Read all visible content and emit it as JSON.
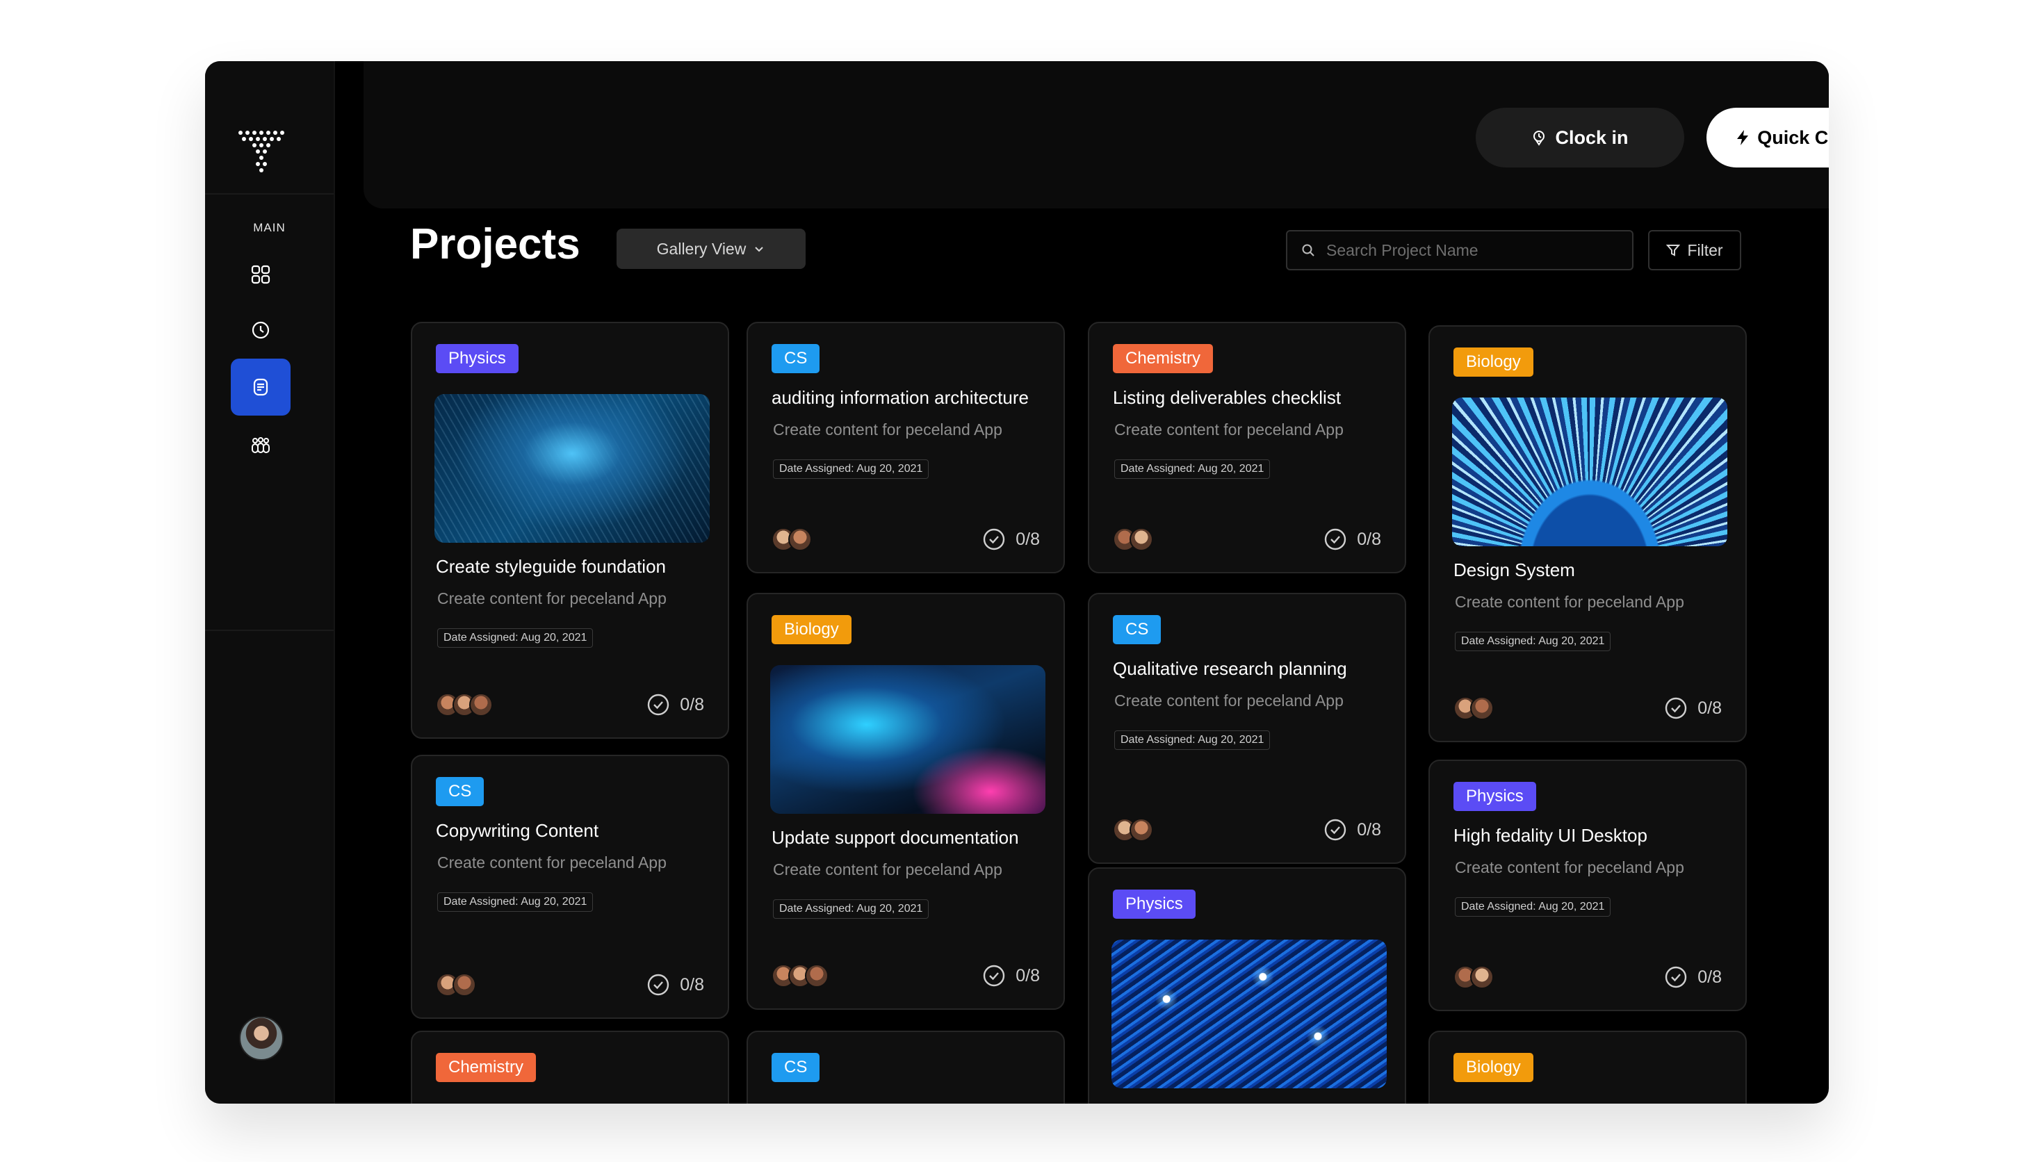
{
  "sidebar": {
    "section_label": "MAIN",
    "items": [
      {
        "icon": "grid-icon"
      },
      {
        "icon": "clock-icon"
      },
      {
        "icon": "projects-icon",
        "active": true
      },
      {
        "icon": "team-icon"
      }
    ]
  },
  "topbar": {
    "clock_in_label": "Clock in",
    "quick_clock_in_label": "Quick Clock in"
  },
  "header": {
    "title": "Projects",
    "view_selected": "Gallery View",
    "search_placeholder": "Search Project Name",
    "filter_label": "Filter"
  },
  "tag_colors": {
    "Physics": "#5b4cf5",
    "CS": "#1e9bf0",
    "Chemistry": "#f0673a",
    "Biology": "#f29b0c"
  },
  "cards": [
    {
      "tag": "Physics",
      "image": "dna",
      "title": "Create styleguide foundation",
      "subtitle": "Create content for peceland App",
      "date": "Date Assigned: Aug 20, 2021",
      "progress": "0/8",
      "avatars": 3
    },
    {
      "tag": "CS",
      "title": "Copywriting Content",
      "subtitle": "Create content for peceland App",
      "date": "Date Assigned: Aug 20, 2021",
      "progress": "0/8",
      "avatars": 2
    },
    {
      "tag": "Chemistry"
    },
    {
      "tag": "CS",
      "title": "auditing information architecture",
      "subtitle": "Create content for peceland App",
      "date": "Date Assigned: Aug 20, 2021",
      "progress": "0/8",
      "avatars": 2
    },
    {
      "tag": "Biology",
      "image": "waves",
      "title": "Update support documentation",
      "subtitle": "Create content for peceland App",
      "date": "Date Assigned: Aug 20, 2021",
      "progress": "0/8",
      "avatars": 3
    },
    {
      "tag": "CS"
    },
    {
      "tag": "Chemistry",
      "title": "Listing deliverables checklist",
      "subtitle": "Create content for peceland App",
      "date": "Date Assigned: Aug 20, 2021",
      "progress": "0/8",
      "avatars": 2
    },
    {
      "tag": "CS",
      "title": "Qualitative research planning",
      "subtitle": "Create content for peceland App",
      "date": "Date Assigned: Aug 20, 2021",
      "progress": "0/8",
      "avatars": 2
    },
    {
      "tag": "Physics",
      "image": "circuit"
    },
    {
      "tag": "Biology",
      "image": "burst",
      "title": "Design System",
      "subtitle": "Create content for peceland App",
      "date": "Date Assigned: Aug 20, 2021",
      "progress": "0/8",
      "avatars": 2
    },
    {
      "tag": "Physics",
      "title": "High fedality UI Desktop",
      "subtitle": "Create content for peceland App",
      "date": "Date Assigned: Aug 20, 2021",
      "progress": "0/8",
      "avatars": 2
    },
    {
      "tag": "Biology"
    }
  ]
}
